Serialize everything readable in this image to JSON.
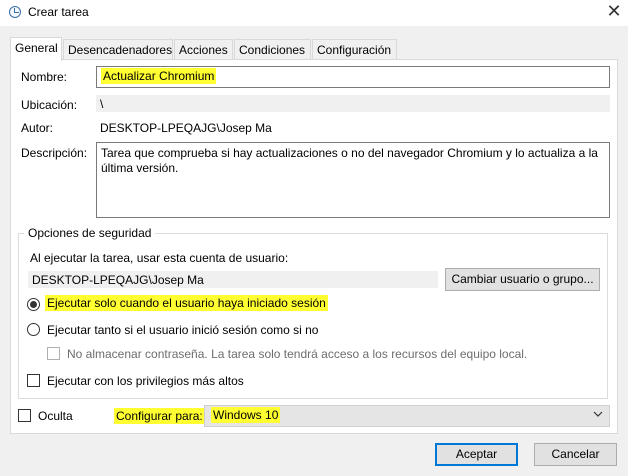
{
  "window": {
    "title": "Crear tarea",
    "close_icon": "close-icon"
  },
  "tabs": [
    {
      "label": "General",
      "active": true
    },
    {
      "label": "Desencadenadores",
      "active": false
    },
    {
      "label": "Acciones",
      "active": false
    },
    {
      "label": "Condiciones",
      "active": false
    },
    {
      "label": "Configuración",
      "active": false
    }
  ],
  "general": {
    "name_label": "Nombre:",
    "name_value": "Actualizar Chromium",
    "location_label": "Ubicación:",
    "location_value": "\\",
    "author_label": "Autor:",
    "author_value": "DESKTOP-LPEQAJG\\Josep Ma",
    "description_label": "Descripción:",
    "description_value": "Tarea que comprueba si hay actualizaciones o no del navegador Chromium y lo actualiza a la última versión."
  },
  "security": {
    "group_title": "Opciones de seguridad",
    "account_prompt": "Al ejecutar la tarea, usar esta cuenta de usuario:",
    "account_value": "DESKTOP-LPEQAJG\\Josep Ma",
    "change_user_button": "Cambiar usuario o grupo...",
    "radio_logged_on": "Ejecutar solo cuando el usuario haya iniciado sesión",
    "radio_logged_on_selected": true,
    "radio_whether": "Ejecutar tanto si el usuario inició sesión como si no",
    "no_store_password": "No almacenar contraseña. La tarea solo tendrá acceso a los recursos del equipo local.",
    "highest_privileges": "Ejecutar con los privilegios más altos"
  },
  "footer": {
    "hidden_label": "Oculta",
    "configure_for_label": "Configurar para:",
    "configure_for_value": "Windows 10",
    "accept_button": "Aceptar",
    "cancel_button": "Cancelar"
  },
  "colors": {
    "highlight": "#ffff32",
    "accent": "#0078d7"
  }
}
